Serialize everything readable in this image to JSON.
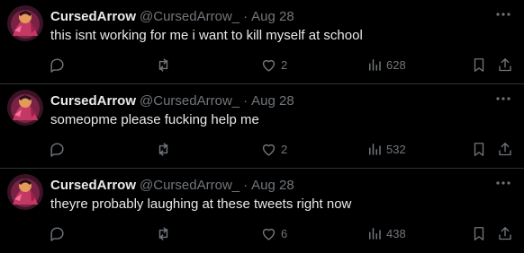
{
  "colors": {
    "background": "#000000",
    "primary_text": "#e7e9ea",
    "secondary_text": "#71767b",
    "divider": "#2f3336"
  },
  "icons": [
    "more-icon",
    "reply-icon",
    "retweet-icon",
    "like-icon",
    "views-icon",
    "bookmark-icon",
    "share-icon"
  ],
  "tweets": [
    {
      "name": "CursedArrow",
      "handle": "@CursedArrow_",
      "separator": "·",
      "date": "Aug 28",
      "text": "this isnt working for me i want to kill myself at school",
      "likes": "2",
      "views": "628"
    },
    {
      "name": "CursedArrow",
      "handle": "@CursedArrow_",
      "separator": "·",
      "date": "Aug 28",
      "text": "someopme please fucking help me",
      "likes": "2",
      "views": "532"
    },
    {
      "name": "CursedArrow",
      "handle": "@CursedArrow_",
      "separator": "·",
      "date": "Aug 28",
      "text": "theyre probably laughing at these tweets right now",
      "likes": "6",
      "views": "438"
    }
  ]
}
